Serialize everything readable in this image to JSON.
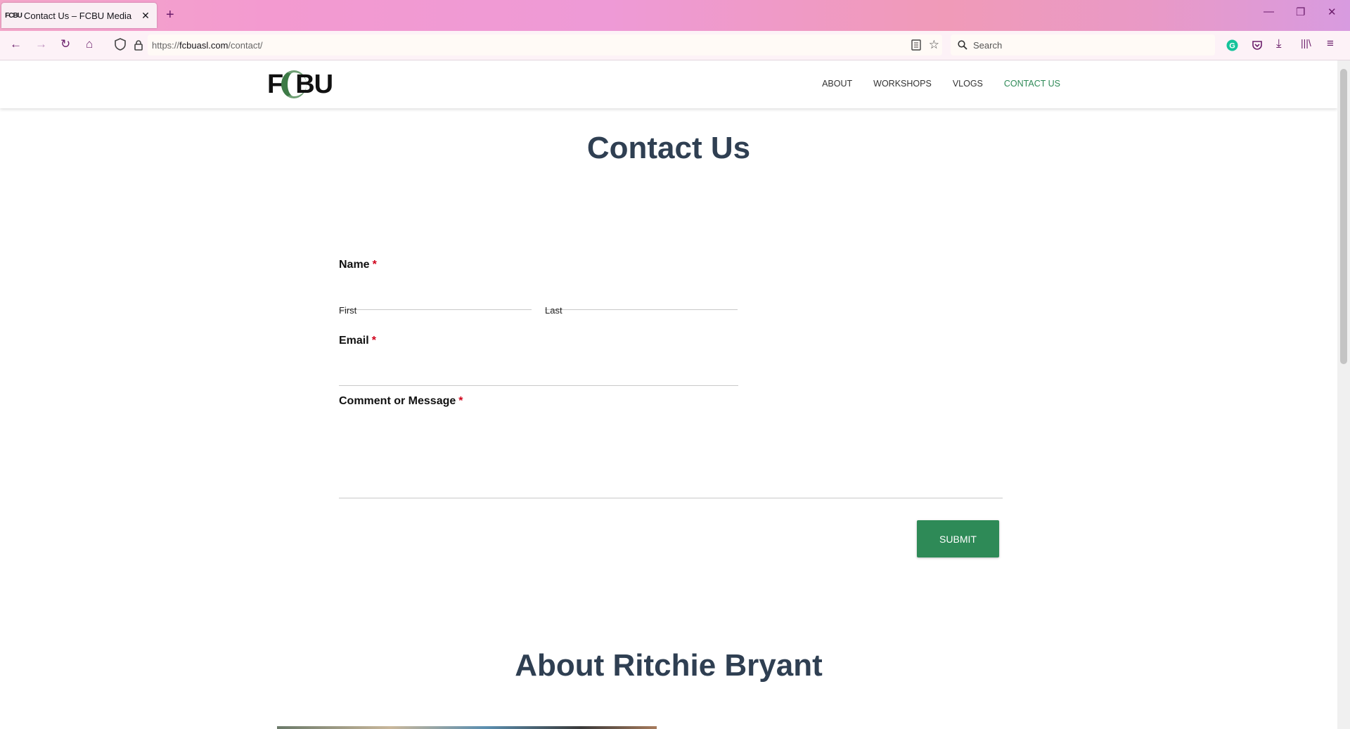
{
  "browser": {
    "tab_title": "Contact Us – FCBU Media",
    "tab_favicon": "FCBU",
    "url_prefix": "https://",
    "url_domain": "fcbuasl.com",
    "url_path": "/contact/",
    "search_placeholder": "Search"
  },
  "site": {
    "logo_left": "F",
    "logo_right": "BU",
    "nav": [
      "ABOUT",
      "WORKSHOPS",
      "VLOGS",
      "CONTACT US"
    ],
    "active_nav": "CONTACT US",
    "accent_color": "#2e8a57"
  },
  "form": {
    "title": "Contact Us",
    "name_label": "Name",
    "first_label": "First",
    "last_label": "Last",
    "email_label": "Email",
    "message_label": "Comment or Message",
    "required_marker": "*",
    "submit_label": "SUBMIT"
  },
  "about": {
    "title": "About Ritchie Bryant"
  }
}
